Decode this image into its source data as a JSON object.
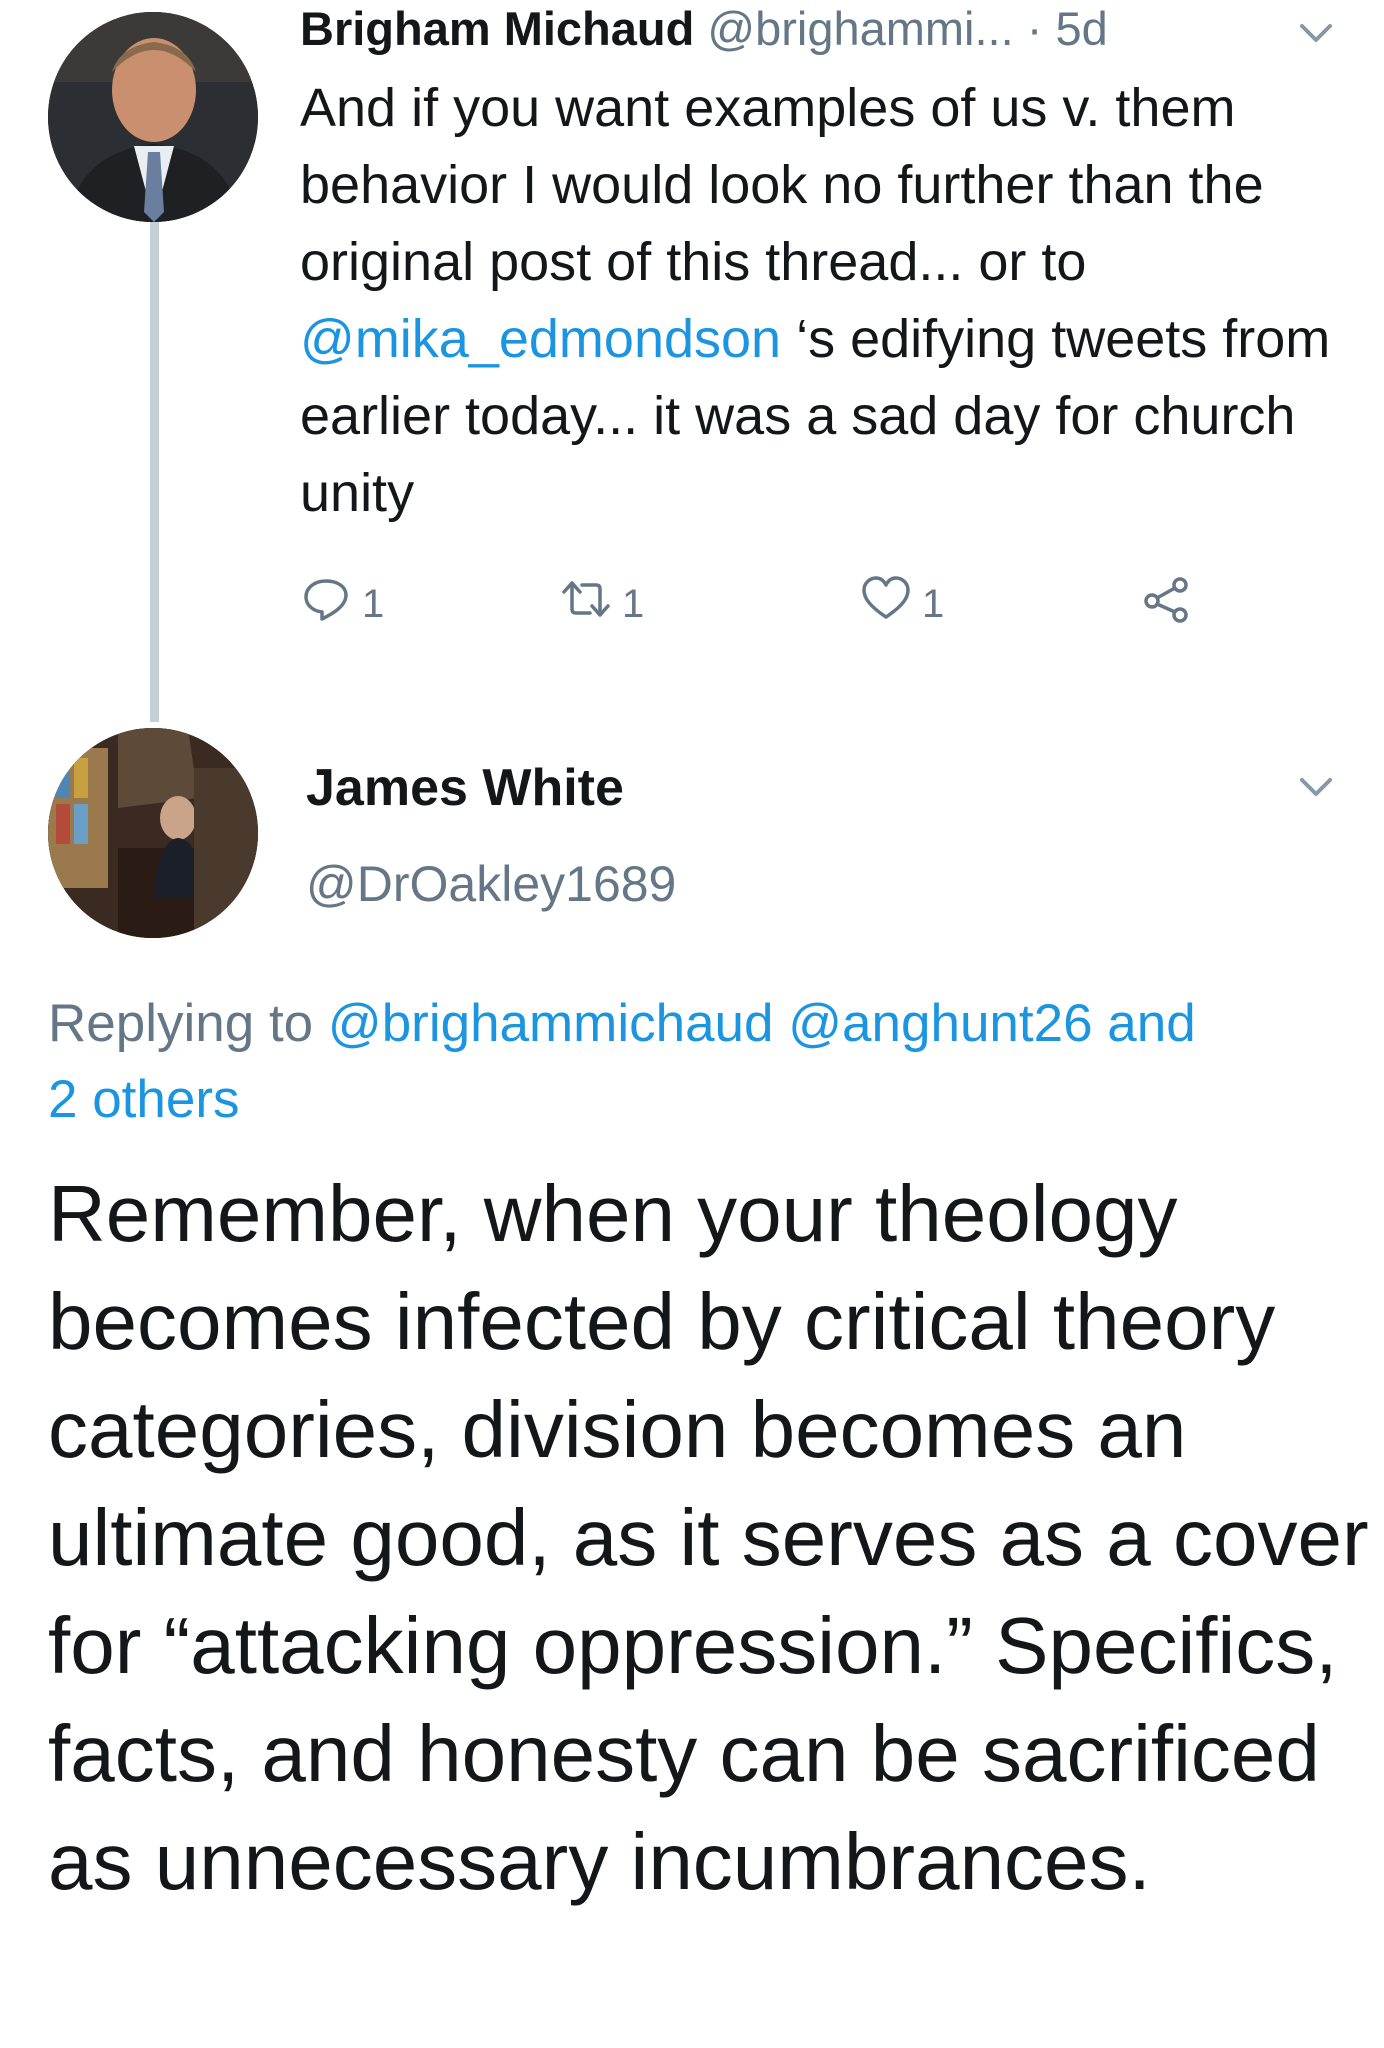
{
  "reply_tweet": {
    "display_name": "Brigham Michaud",
    "handle": "@brighammi...",
    "separator": "·",
    "timestamp": "5d",
    "body": {
      "part1": "And if you want examples of us v. them behavior I would look no further than the original post of this thread... or to ",
      "mention": "@mika_edmondson",
      "part2": " ‘s edifying tweets from earlier today... it was a sad day for church unity"
    },
    "actions": {
      "reply_count": "1",
      "retweet_count": "1",
      "like_count": "1"
    }
  },
  "main_tweet": {
    "display_name": "James White",
    "handle": "@DrOakley1689",
    "replying_prefix": "Replying to ",
    "reply_mention_1": "@brighammichaud",
    "reply_mention_2": "@anghunt26",
    "reply_mention_joiner": " and",
    "reply_others": "2 others",
    "text": "Remember, when your theology becomes infected by critical theory categories, division becomes an ultimate good, as it serves as a cover for “attacking oppression.” Specifics, facts, and honesty can be sacrificed as unnecessary incumbrances."
  },
  "colors": {
    "link": "#1b95e0",
    "secondary_text": "#657786",
    "thread_line": "#c4cfd6"
  },
  "icons": {
    "reply": "reply-icon",
    "retweet": "retweet-icon",
    "like": "heart-icon",
    "share": "share-icon",
    "caret": "chevron-down-icon"
  }
}
